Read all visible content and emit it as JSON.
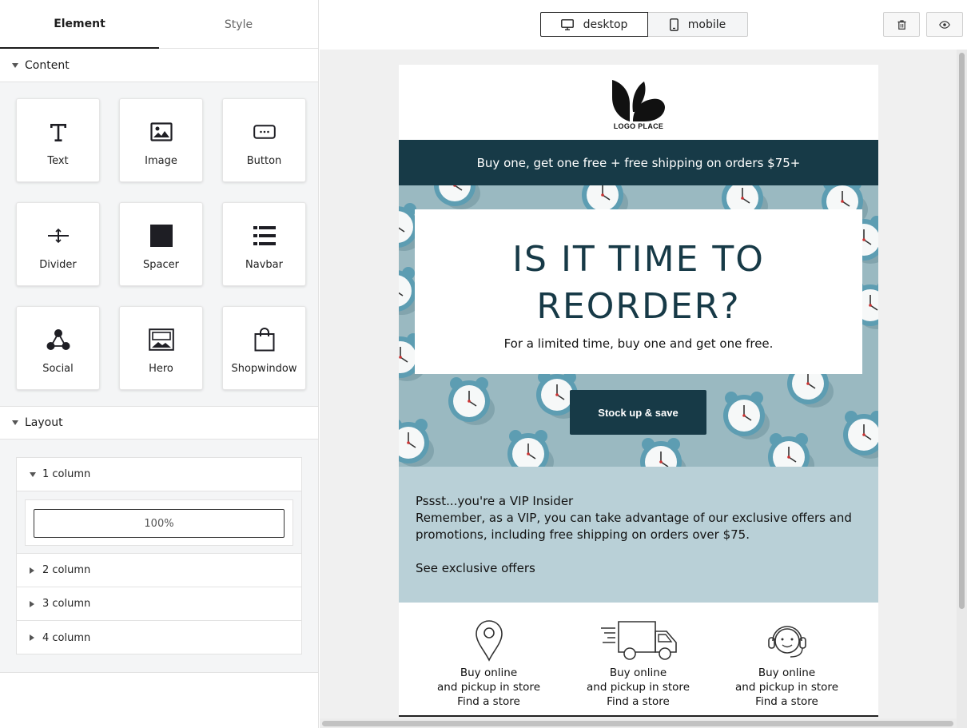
{
  "tabs": {
    "element": "Element",
    "style": "Style"
  },
  "content_section": {
    "title": "Content",
    "blocks": [
      {
        "label": "Text",
        "icon": "text-icon"
      },
      {
        "label": "Image",
        "icon": "image-icon"
      },
      {
        "label": "Button",
        "icon": "button-icon"
      },
      {
        "label": "Divider",
        "icon": "divider-icon"
      },
      {
        "label": "Spacer",
        "icon": "spacer-icon"
      },
      {
        "label": "Navbar",
        "icon": "navbar-icon"
      },
      {
        "label": "Social",
        "icon": "social-icon"
      },
      {
        "label": "Hero",
        "icon": "hero-icon"
      },
      {
        "label": "Shopwindow",
        "icon": "shopping-bag-icon"
      }
    ]
  },
  "layout_section": {
    "title": "Layout",
    "columns": [
      {
        "label": "1 column",
        "expanded": true
      },
      {
        "label": "2 column",
        "expanded": false
      },
      {
        "label": "3 column",
        "expanded": false
      },
      {
        "label": "4 column",
        "expanded": false
      }
    ],
    "one_column_preview": "100%"
  },
  "toolbar": {
    "desktop": "desktop",
    "mobile": "mobile",
    "active_device": "desktop"
  },
  "email": {
    "logo_text": "LOGO PLACE",
    "promo": "Buy one, get one free + free shipping on orders $75+",
    "hero_title": "IS IT TIME TO REORDER?",
    "hero_subtitle": "For a limited time, buy one and get one free.",
    "hero_button": "Stock up & save",
    "vip_title": "Pssst...you're a VIP Insider",
    "vip_body": "Remember, as a VIP, you can take advantage of our exclusive offers and promotions, including free shipping on orders over $75.",
    "vip_link": "See exclusive offers",
    "features": [
      {
        "icon": "location-pin-icon",
        "line1": "Buy online",
        "line2": "and pickup in store",
        "link": "Find a store"
      },
      {
        "icon": "delivery-truck-icon",
        "line1": "Buy online",
        "line2": "and pickup in store",
        "link": "Find a store"
      },
      {
        "icon": "customer-support-icon",
        "line1": "Buy online",
        "line2": "and pickup in store",
        "link": "Find a store"
      }
    ]
  },
  "colors": {
    "brand_dark": "#173a47",
    "hero_bg": "#9ab9c1",
    "vip_bg": "#b9d0d7",
    "panel_bg": "#f4f5f6"
  }
}
